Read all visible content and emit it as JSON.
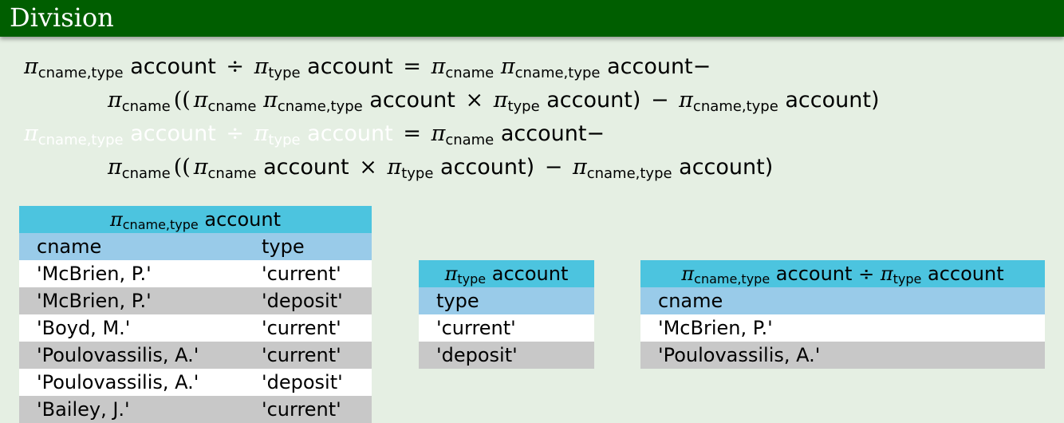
{
  "title": "Division",
  "equations": {
    "line1": {
      "pi": "π",
      "sub_a": "cname,type",
      "rel_a": "account",
      "div": "÷",
      "sub_b": "type",
      "rel_b": "account",
      "eq": "=",
      "sub_c": "cname",
      "sub_d": "cname,type",
      "rel_c": "account−"
    },
    "line2": {
      "sub_a": "cname",
      "open": "((",
      "sub_b": "cname",
      "sub_c": "cname,type",
      "rel_a": "account",
      "times": "×",
      "sub_d": "type",
      "rel_b": "account)",
      "minus": "−",
      "sub_e": "cname,type",
      "rel_c": "account)"
    },
    "line3": {
      "sub_a": "cname,type",
      "rel_a": "account",
      "div": "÷",
      "sub_b": "type",
      "rel_b": "account",
      "eq": "=",
      "sub_c": "cname",
      "rel_c": "account−"
    },
    "line4": {
      "sub_a": "cname",
      "open": "((",
      "sub_b": "cname",
      "rel_a": "account",
      "times": "×",
      "sub_c": "type",
      "rel_b": "account)",
      "minus": "−",
      "sub_d": "cname,type",
      "rel_c": "account)"
    }
  },
  "table_account": {
    "header_sub": "cname,type",
    "header_rel": "account",
    "columns": [
      "cname",
      "type"
    ],
    "rows": [
      [
        "'McBrien, P.'",
        "'current'"
      ],
      [
        "'McBrien, P.'",
        "'deposit'"
      ],
      [
        "'Boyd, M.'",
        "'current'"
      ],
      [
        "'Poulovassilis, A.'",
        "'current'"
      ],
      [
        "'Poulovassilis, A.'",
        "'deposit'"
      ],
      [
        "'Bailey, J.'",
        "'current'"
      ]
    ]
  },
  "table_type": {
    "header_sub": "type",
    "header_rel": "account",
    "columns": [
      "type"
    ],
    "rows": [
      [
        "'current'"
      ],
      [
        "'deposit'"
      ]
    ]
  },
  "table_result": {
    "header_sub_a": "cname,type",
    "header_rel_a": "account",
    "div": "÷",
    "header_sub_b": "type",
    "header_rel_b": "account",
    "columns": [
      "cname"
    ],
    "rows": [
      [
        "'McBrien, P.'"
      ],
      [
        "'Poulovassilis, A.'"
      ]
    ]
  }
}
